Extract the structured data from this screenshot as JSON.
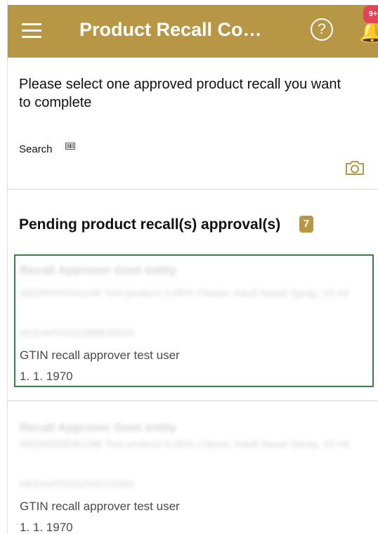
{
  "app": {
    "title": "Product Recall Co…",
    "notification_count": "9+",
    "menu_icon": "hamburger-menu-icon",
    "help_icon": "help-circle-icon",
    "notification_icon": "bell-icon"
  },
  "content": {
    "instruction": "Please select one approved product recall you want to complete",
    "search_label": "Search",
    "barcode_icon": "barcode-icon",
    "camera_icon": "camera-icon",
    "pending_title": "Pending product recall(s) approval(s)",
    "pending_count": "7"
  },
  "recalls": [
    {
      "entity": "Recall Approver Govt entity",
      "product": "06295000041199 Test product 0.05% Classic Adult Nasal Spray, 10 ml",
      "reference": "MOHAP/O/22/68830034",
      "user": "GTIN recall approver test user",
      "date": "1. 1. 1970",
      "selected": true
    },
    {
      "entity": "Recall Approver Govt entity",
      "product": "06295000041298 Test product 0.05% Classic Adult Nasal Spray, 10 ml",
      "reference": "MOHAP/O/22/54572994",
      "user": "GTIN recall approver test user",
      "date": "1. 1. 1970",
      "selected": false
    }
  ],
  "colors": {
    "accent": "#b79745",
    "selected_border": "#3c7d43",
    "notification_badge": "#e44457"
  }
}
